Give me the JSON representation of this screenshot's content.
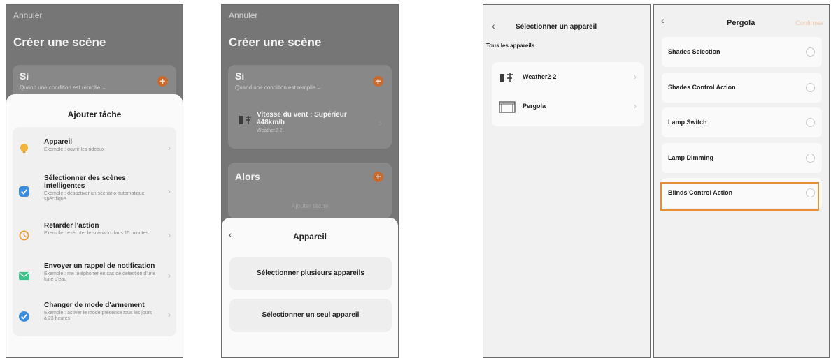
{
  "screen1": {
    "cancel": "Annuler",
    "title": "Créer une scène",
    "if_label": "Si",
    "if_sub": "Quand une condition est remplie ⌄",
    "sheet_title": "Ajouter tâche",
    "tasks": [
      {
        "main": "Appareil",
        "sub": "Exemple : ouvrir les rideaux",
        "icon": "lightbulb-icon",
        "color": "#f2b33a"
      },
      {
        "main": "Sélectionner des scènes intelligentes",
        "sub": "Exemple : désactiver un scénario automatique spécifique",
        "icon": "checkbox-icon",
        "color": "#3a8ee0"
      },
      {
        "main": "Retarder l'action",
        "sub": "Exemple : exécuter le scénario dans 15 minutes",
        "icon": "clock-icon",
        "color": "#e8a23e"
      },
      {
        "main": "Envoyer un rappel de notification",
        "sub": "Exemple : me téléphoner en cas de détection d'une fuite d'eau",
        "icon": "mail-icon",
        "color": "#3cc28a"
      },
      {
        "main": "Changer de mode d'armement",
        "sub": "Exemple : activer le mode présence tous les jours à 23 heures",
        "icon": "shield-check-icon",
        "color": "#3a8ee0"
      }
    ]
  },
  "screen2": {
    "cancel": "Annuler",
    "title": "Créer une scène",
    "if_label": "Si",
    "if_sub": "Quand une condition est remplie ⌄",
    "condition_main": "Vitesse du vent : Supérieur à48km/h",
    "condition_device": "Weather2-2",
    "then_label": "Alors",
    "add_task": "Ajouter tâche",
    "sheet_title": "Appareil",
    "options": [
      "Sélectionner plusieurs appareils",
      "Sélectionner un seul appareil"
    ]
  },
  "screen3": {
    "title": "Sélectionner un appareil",
    "filter": "Tous les appareils",
    "devices": [
      {
        "name": "Weather2-2",
        "icon": "weather-station-icon"
      },
      {
        "name": "Pergola",
        "icon": "pergola-icon"
      }
    ]
  },
  "screen4": {
    "title": "Pergola",
    "confirm": "Confirmer",
    "options": [
      "Shades Selection",
      "Shades Control Action",
      "Lamp Switch",
      "Lamp Dimming",
      "Blinds Control Action"
    ],
    "highlight_color": "#e69033"
  }
}
